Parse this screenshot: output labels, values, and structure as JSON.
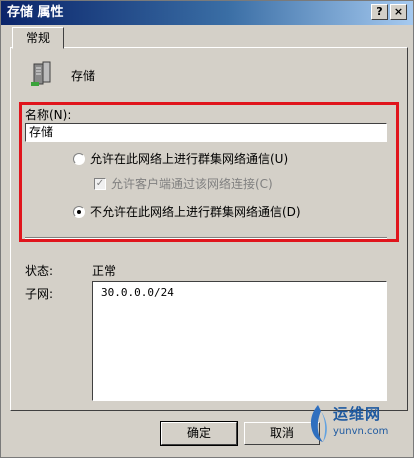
{
  "window": {
    "title": "存储 属性",
    "help_label": "?",
    "close_label": "×"
  },
  "tabs": [
    {
      "label": "常规"
    }
  ],
  "header": {
    "name": "存储",
    "icon": "server-icon"
  },
  "name_field": {
    "label": "名称(N):",
    "value": "存储"
  },
  "options": {
    "allow_cluster_comm": "允许在此网络上进行群集网络通信(U)",
    "allow_client_connect": "允许客户端通过该网络连接(C)",
    "disallow_cluster_comm": "不允许在此网络上进行群集网络通信(D)",
    "selected": "disallow_cluster_comm",
    "client_checked": true
  },
  "status": {
    "label": "状态:",
    "value": "正常"
  },
  "subnet": {
    "label": "子网:",
    "items": [
      "30.0.0.0/24"
    ]
  },
  "buttons": {
    "ok": "确定",
    "cancel": "取消"
  },
  "watermark": {
    "cn": "运维网",
    "en": "yunvn.com"
  },
  "colors": {
    "highlight": "#e0141c",
    "title_bar": "#0a246a",
    "dialog_bg": "#d4d0c8"
  }
}
